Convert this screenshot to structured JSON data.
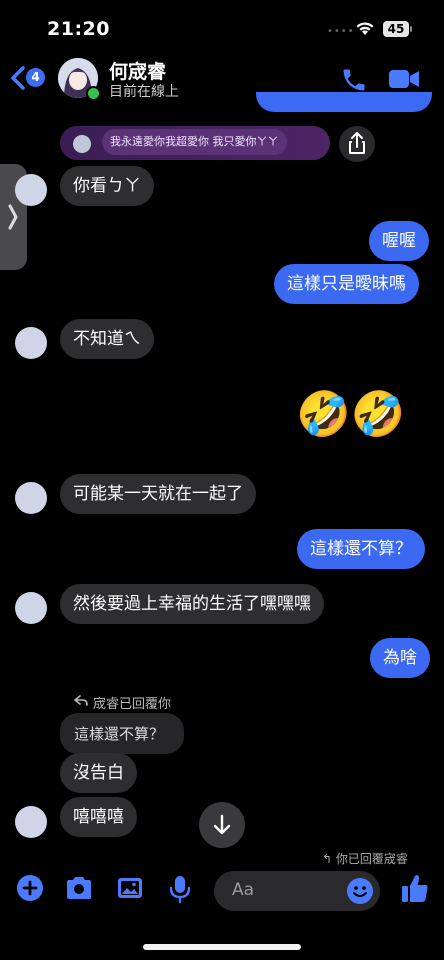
{
  "status_bar": {
    "time": "21:20",
    "battery": "45"
  },
  "header": {
    "back_badge": "4",
    "contact_name": "何宬睿",
    "contact_status": "目前在線上"
  },
  "link_preview": {
    "text": "我永遠愛你我超愛你 我只愛你ㄚㄚ"
  },
  "messages": {
    "m1": "你看ㄅㄚ",
    "m2": "喔喔",
    "m3": "這樣只是曖昧嗎",
    "m4": "不知道ㄟ",
    "m5": "🤣🤣",
    "m6": "可能某一天就在一起了",
    "m7": "這樣還不算？",
    "m8": "然後要過上幸福的生活了嘿嘿嘿",
    "m9": "為啥",
    "reply_tag": "宬睿已回覆你",
    "quoted": "這樣還不算？",
    "m10": "沒告白",
    "m11": "嘻嘻嘻"
  },
  "seen_note": "你已回覆宬睿",
  "composer": {
    "placeholder": "Aa"
  },
  "colors": {
    "accent": "#3b69f2",
    "incoming": "#2e2e30"
  }
}
